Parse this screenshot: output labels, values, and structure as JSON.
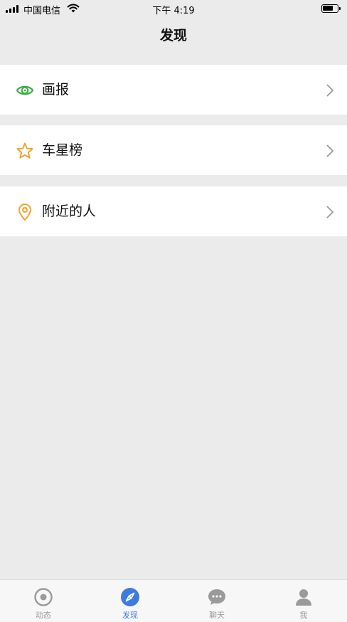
{
  "status_bar": {
    "carrier": "中国电信",
    "time": "下午 4:19",
    "battery_level": 0.75
  },
  "nav": {
    "title": "发现"
  },
  "menu": {
    "items": [
      {
        "label": "画报",
        "icon": "eye-icon",
        "color": "#3fae49"
      },
      {
        "label": "车星榜",
        "icon": "star-icon",
        "color": "#f0a42a"
      },
      {
        "label": "附近的人",
        "icon": "location-pin-icon",
        "color": "#f0a42a"
      }
    ]
  },
  "tab_bar": {
    "active_color": "#3d7bdc",
    "inactive_color": "#9a9a9a",
    "tabs": [
      {
        "label": "动态",
        "icon": "target-icon",
        "active": false
      },
      {
        "label": "发现",
        "icon": "compass-icon",
        "active": true
      },
      {
        "label": "聊天",
        "icon": "chat-bubble-icon",
        "active": false
      },
      {
        "label": "我",
        "icon": "person-icon",
        "active": false
      }
    ]
  }
}
